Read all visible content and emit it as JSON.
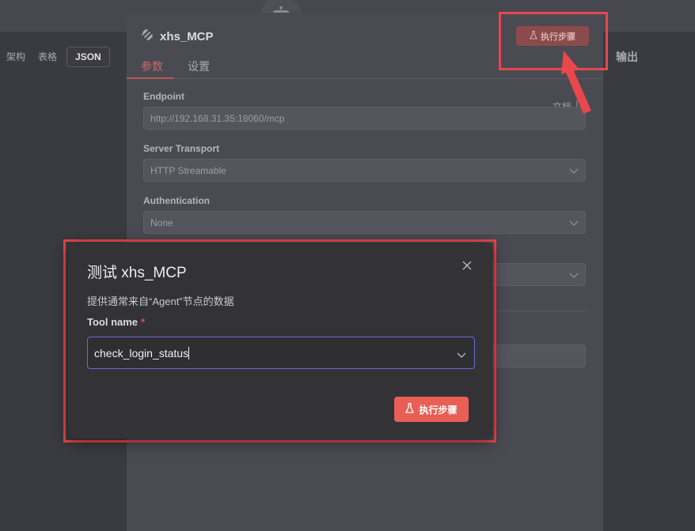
{
  "view_tabs": [
    "架构",
    "表格",
    "JSON"
  ],
  "output_label": "输出",
  "node": {
    "title": "xhs_MCP",
    "exec_label": "执行步骤",
    "tabs": [
      "参数",
      "设置"
    ],
    "doc_link": "文档",
    "fields": {
      "endpoint_label": "Endpoint",
      "endpoint_value": "http://192.168.31.35:18060/mcp",
      "transport_label": "Server Transport",
      "transport_value": "HTTP Streamable",
      "auth_label": "Authentication",
      "auth_value": "None"
    }
  },
  "modal": {
    "title": "测试 xhs_MCP",
    "description": "提供通常来自“Agent”节点的数据",
    "tool_label": "Tool name",
    "required_mark": "*",
    "tool_value": "check_login_status",
    "exec_label": "执行步骤"
  },
  "colors": {
    "accent": "#e85f56",
    "highlight": "#e8474b",
    "focus_border": "#6e66d8"
  }
}
